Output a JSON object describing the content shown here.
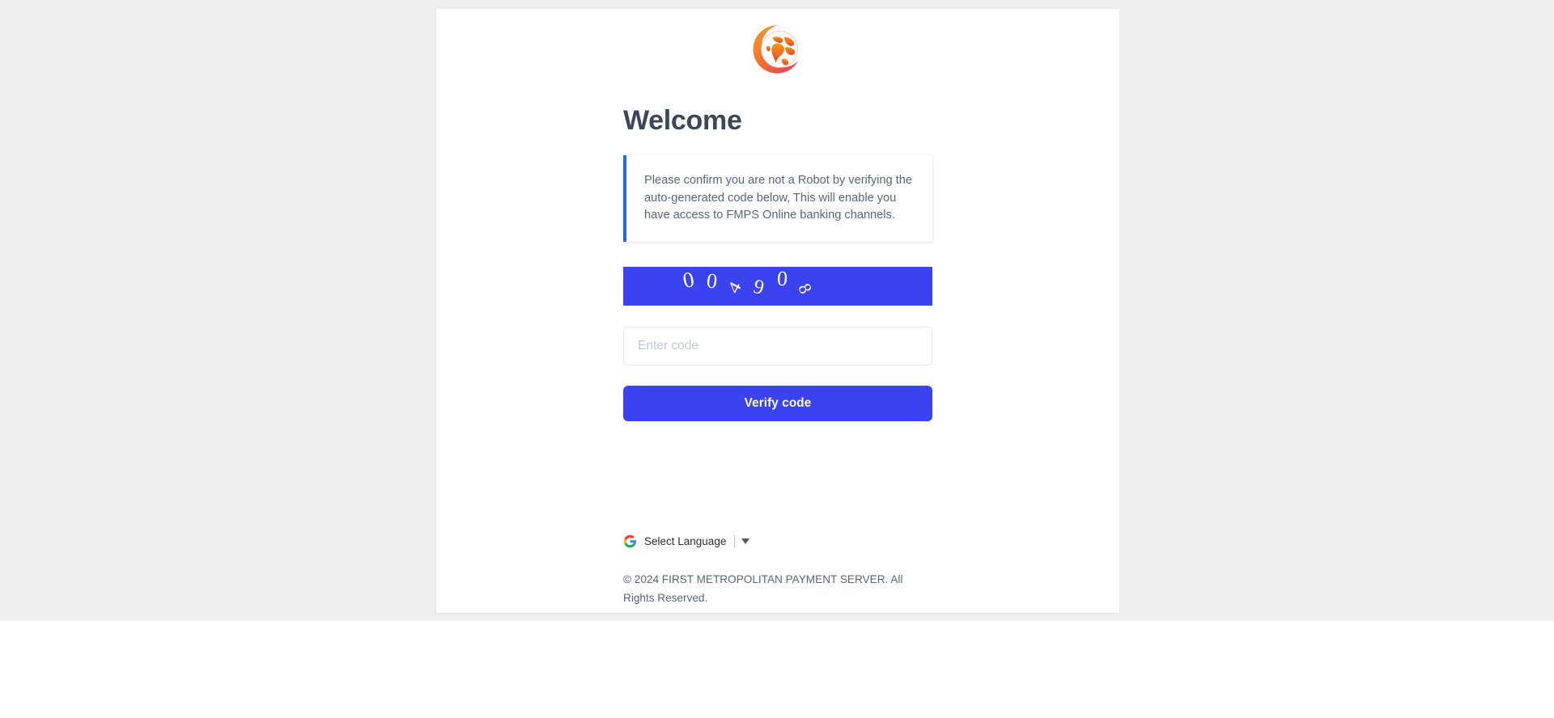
{
  "page": {
    "title": "Welcome"
  },
  "logo": {
    "icon": "globe-logo",
    "alt": "FMPS globe logo"
  },
  "alert": {
    "icon": "info-accent-bar",
    "message": "Please confirm you are not a Robot by verifying the auto-generated code below, This will enable you have access to FMPS Online banking channels."
  },
  "captcha": {
    "icon": "captcha-image",
    "code": "004908",
    "characters": [
      "0",
      "0",
      "4",
      "9",
      "0",
      "8"
    ],
    "background_color": "#3b42f0",
    "text_color": "#ffffff"
  },
  "form": {
    "code_input": {
      "value": "",
      "placeholder": "Enter code"
    },
    "submit_label": "Verify code"
  },
  "translate": {
    "icon": "google-g-icon",
    "label": "Select Language",
    "caret_icon": "chevron-down-icon"
  },
  "footer": {
    "copyright": "© 2024 FIRST METROPOLITAN PAYMENT SERVER. All Rights Reserved."
  },
  "colors": {
    "accent_blue": "#3b42f0",
    "alert_border": "#2563eb",
    "heading": "#3c4858",
    "body_text": "#5a6479",
    "backdrop": "#eeeeee"
  }
}
